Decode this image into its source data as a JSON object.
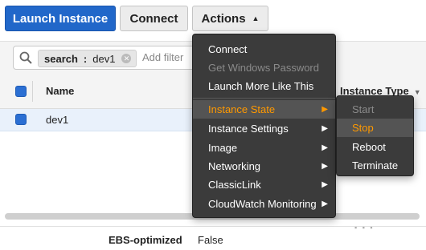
{
  "toolbar": {
    "launch_label": "Launch Instance",
    "connect_label": "Connect",
    "actions_label": "Actions"
  },
  "filter": {
    "chip_key": "search",
    "chip_sep": ":",
    "chip_value": "dev1",
    "add_filter_placeholder": "Add filter"
  },
  "table": {
    "columns": [
      "Name",
      "Instance Type"
    ],
    "rows": [
      {
        "name": "dev1"
      }
    ]
  },
  "details": {
    "ebs_label": "EBS-optimized",
    "ebs_value": "False"
  },
  "actions_menu": {
    "items": [
      {
        "label": "Connect",
        "enabled": true,
        "submenu": false
      },
      {
        "label": "Get Windows Password",
        "enabled": false,
        "submenu": false
      },
      {
        "label": "Launch More Like This",
        "enabled": true,
        "submenu": false
      },
      {
        "label": "Instance State",
        "enabled": true,
        "submenu": true,
        "highlighted": true
      },
      {
        "label": "Instance Settings",
        "enabled": true,
        "submenu": true
      },
      {
        "label": "Image",
        "enabled": true,
        "submenu": true
      },
      {
        "label": "Networking",
        "enabled": true,
        "submenu": true
      },
      {
        "label": "ClassicLink",
        "enabled": true,
        "submenu": true
      },
      {
        "label": "CloudWatch Monitoring",
        "enabled": true,
        "submenu": true
      }
    ]
  },
  "instance_state_menu": {
    "items": [
      {
        "label": "Start",
        "enabled": false
      },
      {
        "label": "Stop",
        "enabled": true,
        "highlighted": true
      },
      {
        "label": "Reboot",
        "enabled": true
      },
      {
        "label": "Terminate",
        "enabled": true
      }
    ]
  },
  "colors": {
    "primary_button": "#2167c9",
    "menu_bg": "#3b3b3b",
    "menu_highlight_text": "#ff9900",
    "selected_row": "#e9f1fb"
  }
}
